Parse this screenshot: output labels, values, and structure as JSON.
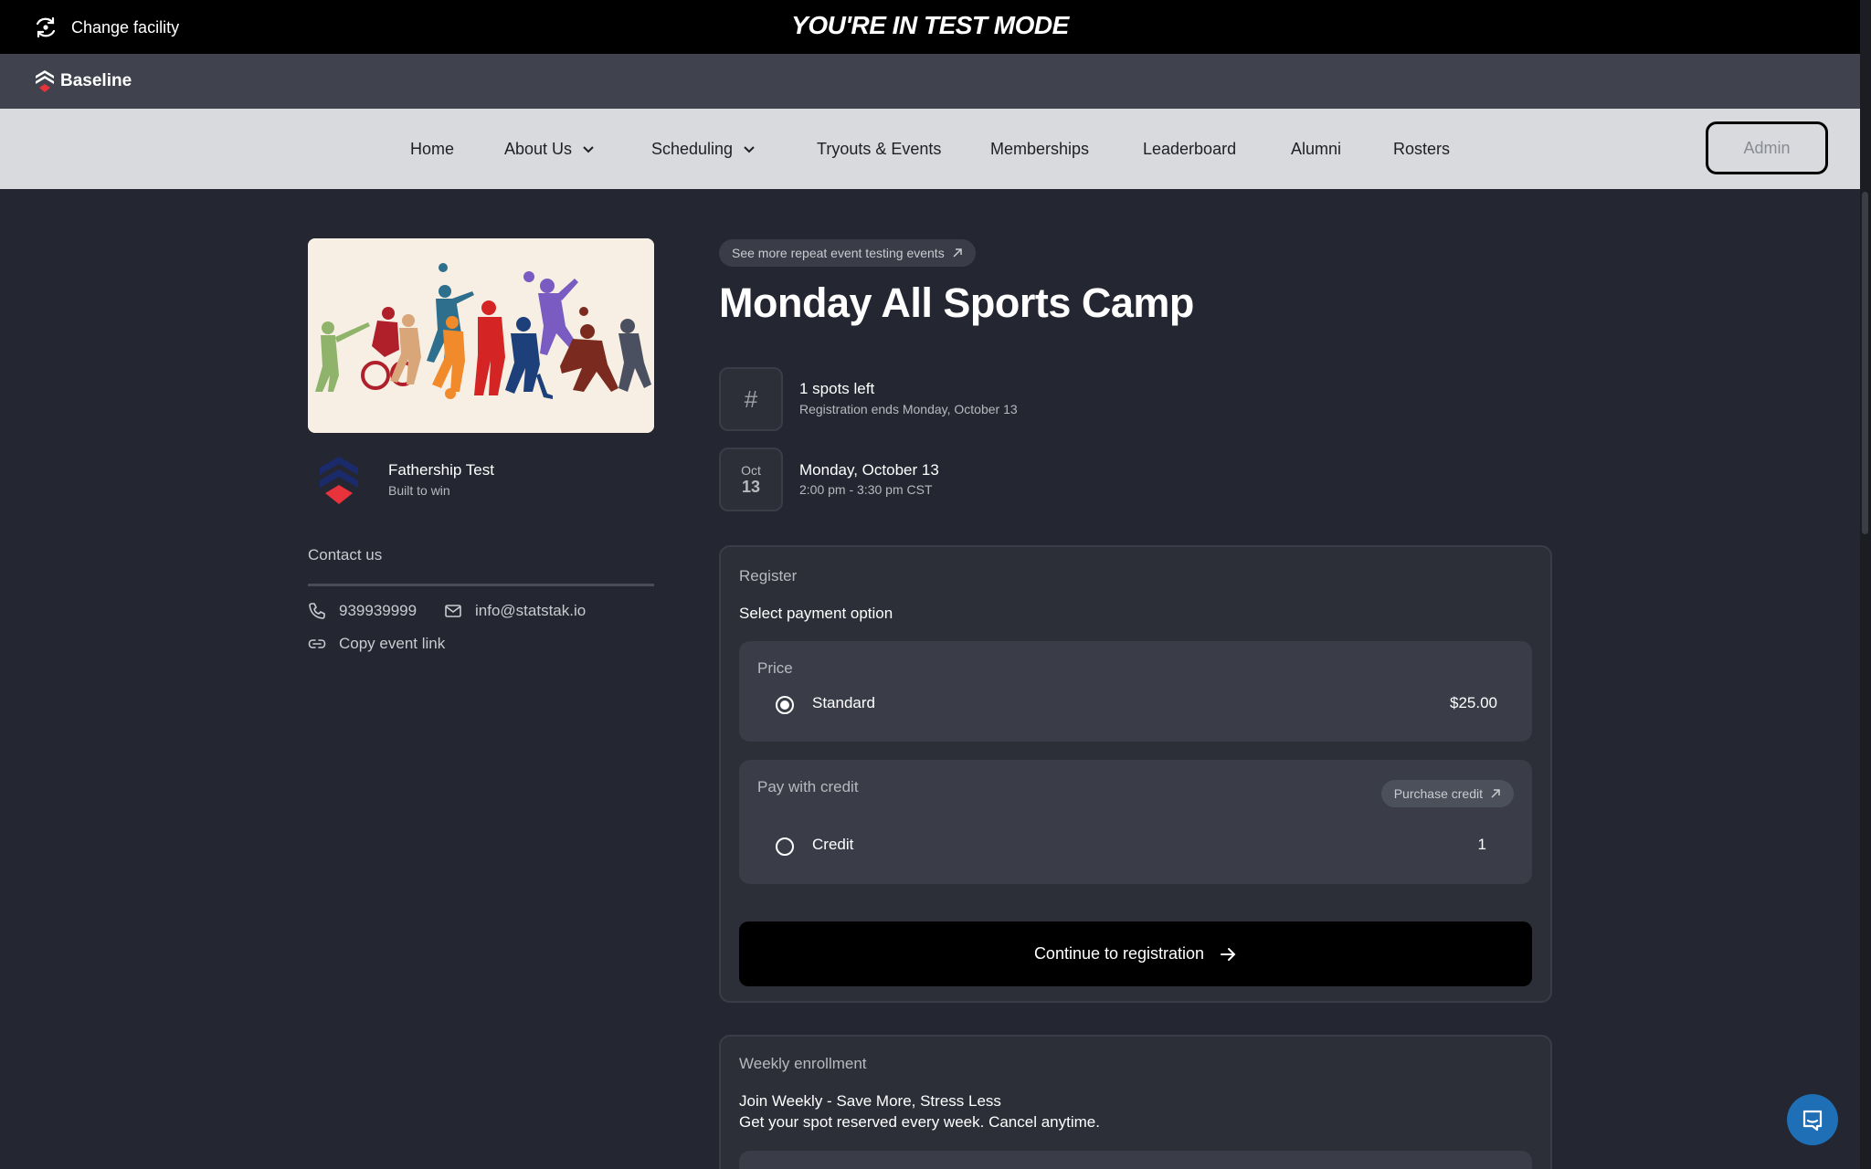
{
  "testbar": {
    "change_facility": "Change facility",
    "mode_text": "YOU'RE IN TEST MODE"
  },
  "brand": {
    "name": "Baseline"
  },
  "nav": {
    "items": [
      {
        "label": "Home",
        "has_dropdown": false
      },
      {
        "label": "About Us",
        "has_dropdown": true
      },
      {
        "label": "Scheduling",
        "has_dropdown": true
      },
      {
        "label": "Tryouts & Events",
        "has_dropdown": false
      },
      {
        "label": "Memberships",
        "has_dropdown": false
      },
      {
        "label": "Leaderboard",
        "has_dropdown": false
      },
      {
        "label": "Alumni",
        "has_dropdown": false
      },
      {
        "label": "Rosters",
        "has_dropdown": false
      }
    ],
    "admin_label": "Admin"
  },
  "organization": {
    "name": "Fathership Test",
    "tagline": "Built to win"
  },
  "contact": {
    "title": "Contact us",
    "phone": "939939999",
    "email": "info@statstak.io",
    "copy_link": "Copy event link"
  },
  "event": {
    "more_link": "See more repeat event testing events",
    "title": "Monday All Sports Camp",
    "spots": "1 spots left",
    "registration_ends": "Registration ends Monday, October 13",
    "month": "Oct",
    "day": "13",
    "date": "Monday, October 13",
    "time": "2:00 pm - 3:30 pm CST"
  },
  "register": {
    "label": "Register",
    "select_payment": "Select payment option",
    "price_label": "Price",
    "standard_label": "Standard",
    "standard_price": "$25.00",
    "credit_section_label": "Pay with credit",
    "purchase_credit": "Purchase credit",
    "credit_label": "Credit",
    "credit_count": "1",
    "continue_label": "Continue to registration",
    "selected_option": "Standard"
  },
  "weekly": {
    "label": "Weekly enrollment",
    "headline": "Join Weekly - Save More, Stress Less",
    "description": "Get your spot reserved every week. Cancel anytime."
  },
  "colors": {
    "page_bg": "#242731",
    "testbar_bg": "#000000",
    "brandbar_bg": "#40434e",
    "navbar_bg": "#d9dadd",
    "card_bg": "#2c2f38",
    "chat_button": "#1f6fb6",
    "logo_red": "#e8323c"
  },
  "icons": {
    "change_facility": "refresh-location-icon",
    "dropdown": "chevron-down-icon",
    "external": "arrow-up-right-icon",
    "phone": "phone-icon",
    "email": "mail-icon",
    "link": "link-icon",
    "continue": "arrow-right-icon",
    "chat": "chat-icon"
  }
}
